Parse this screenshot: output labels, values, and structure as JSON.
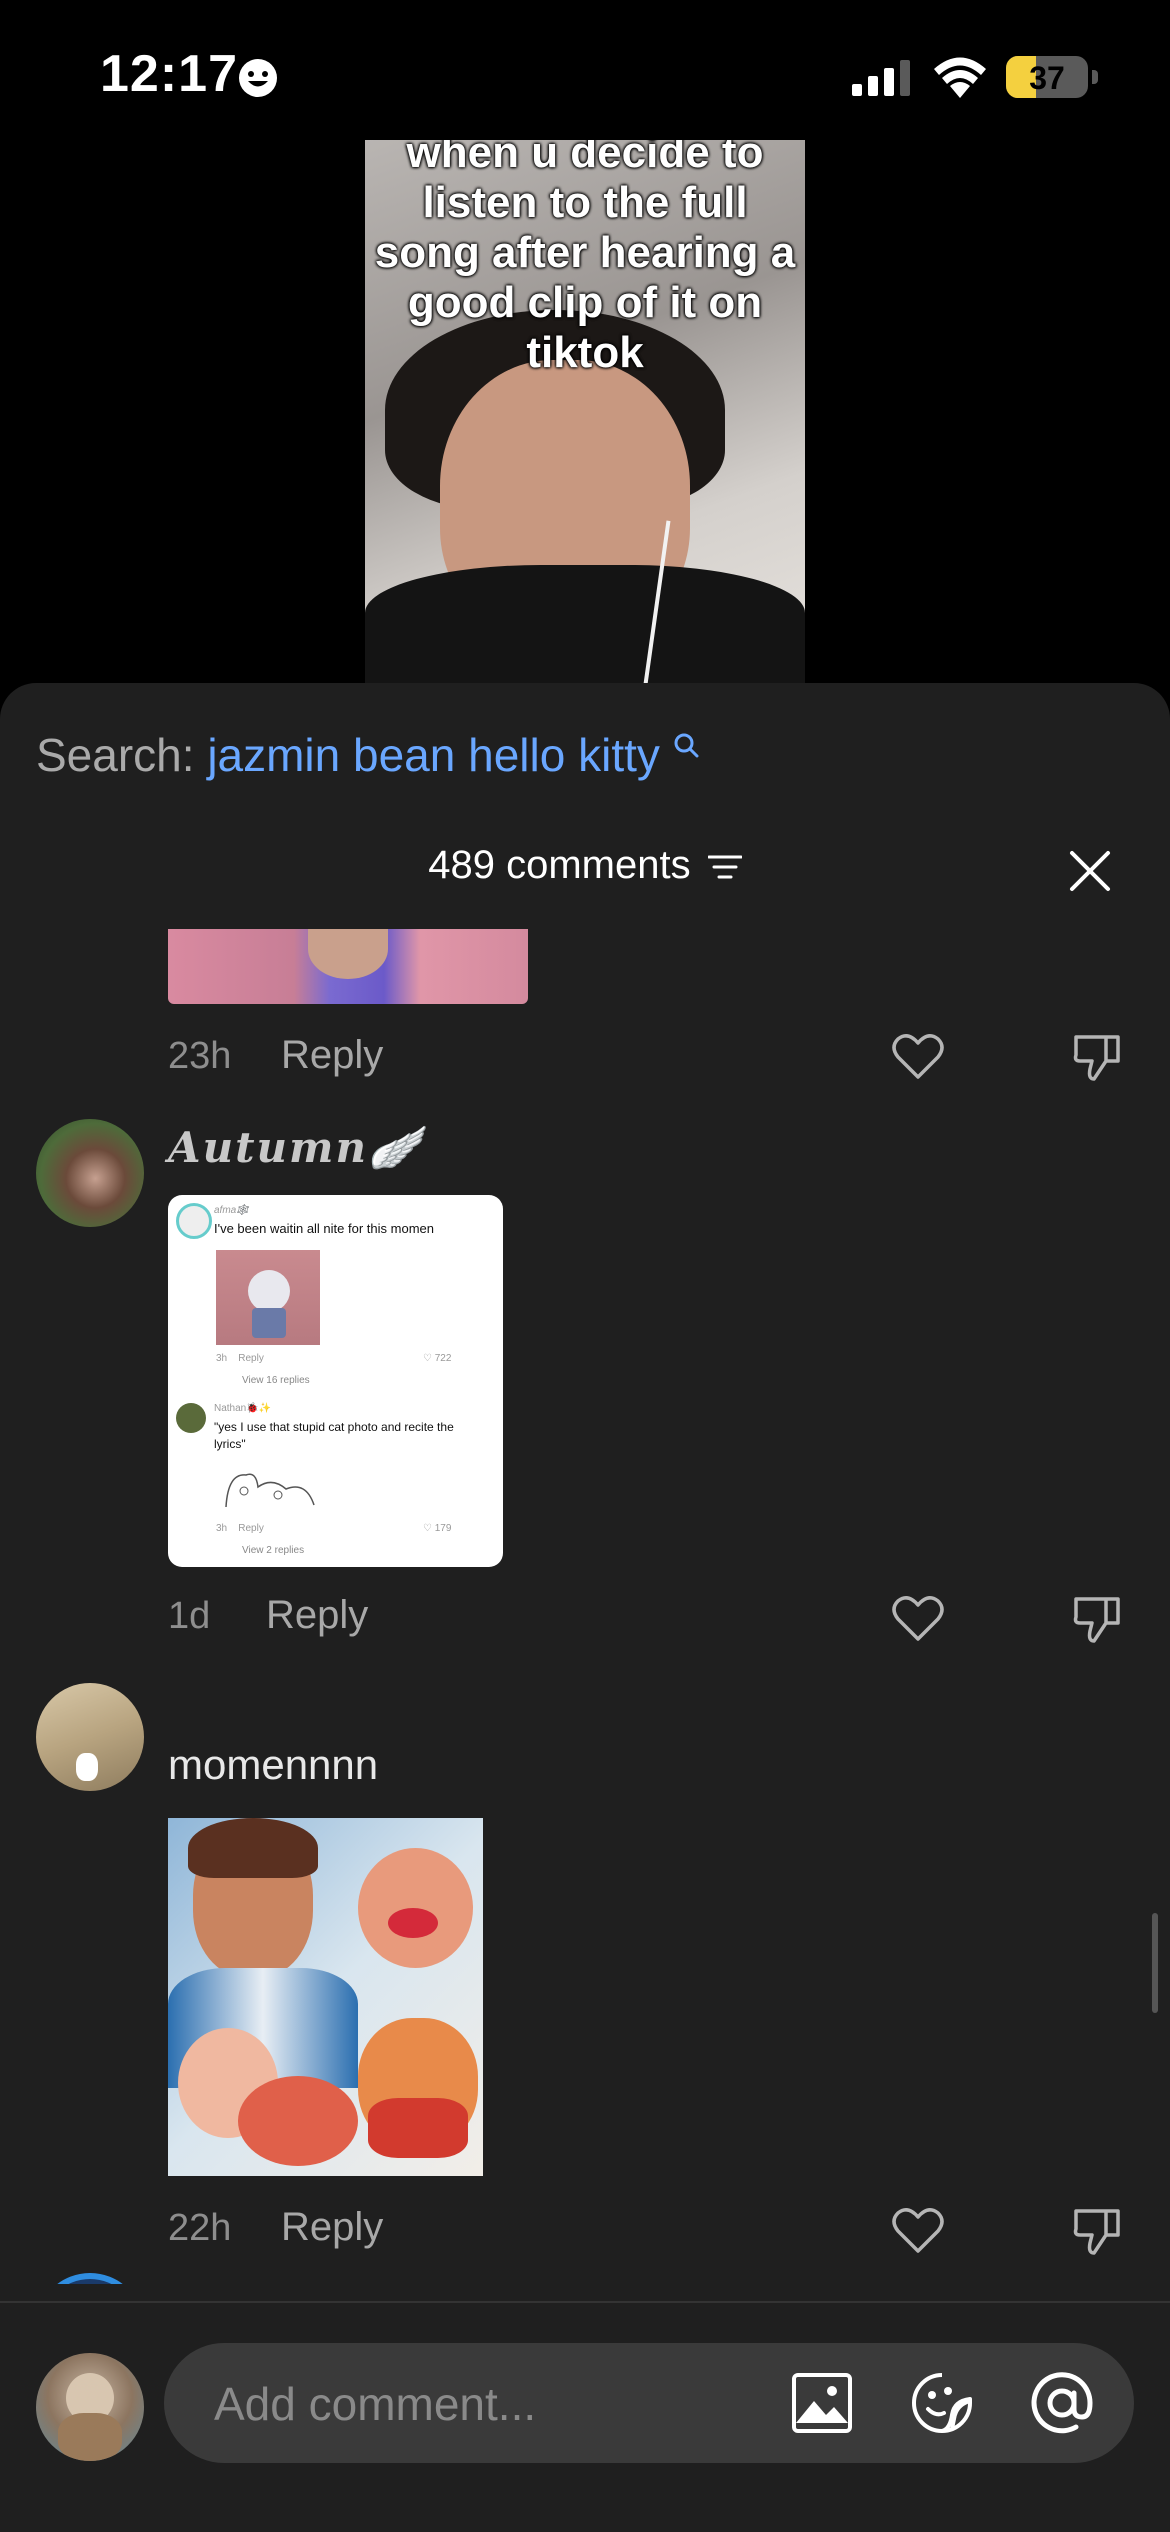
{
  "status_bar": {
    "time": "12:17",
    "battery": "37",
    "battery_level": 0.37
  },
  "video": {
    "caption": "when u decide to listen to the full song after hearing a good clip of it on tiktok"
  },
  "search": {
    "label": "Search:",
    "query": "jazmin bean hello kitty"
  },
  "comments_header": {
    "count_label": "489 comments"
  },
  "comments": [
    {
      "time": "23h",
      "reply": "Reply"
    },
    {
      "username": "𝑨𝒖𝒕𝒖𝒎𝒏🪽",
      "time": "1d",
      "reply": "Reply",
      "embedded": {
        "user1": "afma🕸️",
        "text1": "I've been waitin all nite for this momen",
        "meta1_time": "3h",
        "meta1_reply": "Reply",
        "meta1_likes": "722",
        "view1": "View 16 replies",
        "user2": "Nathan🐞✨",
        "text2": "\"yes I use that stupid cat photo and recite the lyrics\"",
        "meta2_time": "3h",
        "meta2_reply": "Reply",
        "meta2_likes": "179",
        "view2": "View 2 replies"
      }
    },
    {
      "username": "momennnn",
      "time": "22h",
      "reply": "Reply"
    }
  ],
  "input": {
    "placeholder": "Add comment..."
  },
  "icons": {
    "search": "search-icon",
    "filter": "filter-icon",
    "close": "close-icon",
    "heart": "heart-icon",
    "dislike": "thumbs-down-icon",
    "image": "image-icon",
    "sticker": "sticker-icon",
    "mention": "at-mention-icon"
  }
}
